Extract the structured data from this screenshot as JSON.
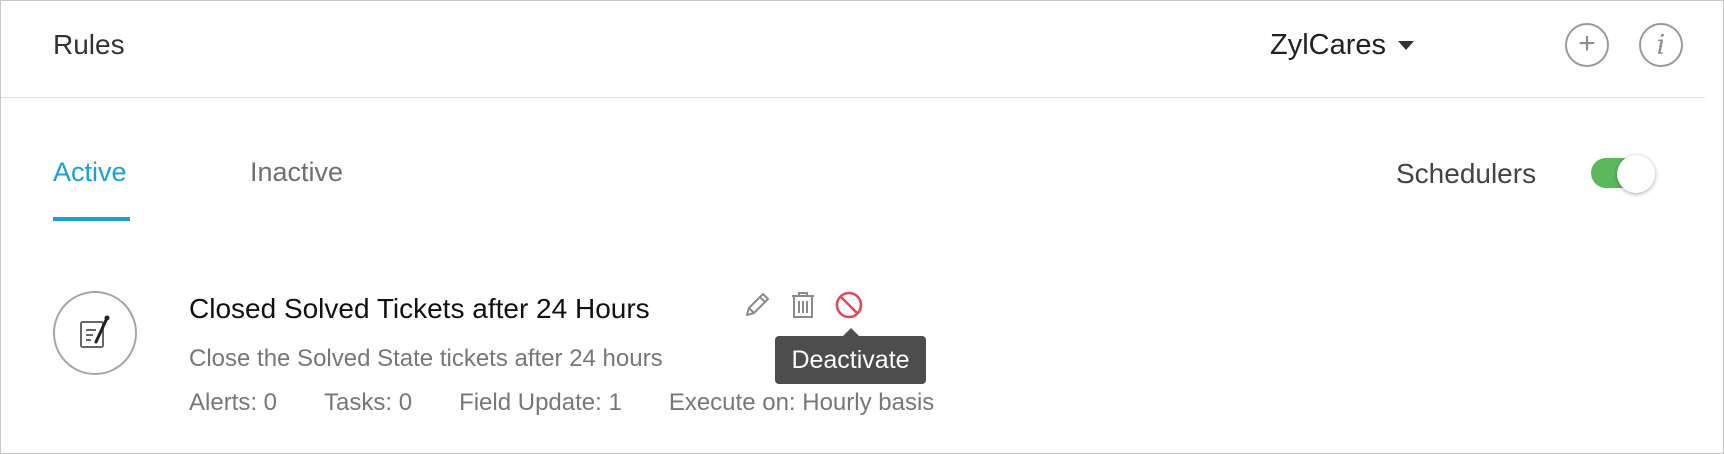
{
  "header": {
    "title": "Rules",
    "org_name": "ZylCares",
    "add_icon": "plus-circle-icon",
    "info_icon": "info-circle-icon"
  },
  "tabs": [
    {
      "label": "Active",
      "selected": true
    },
    {
      "label": "Inactive",
      "selected": false
    }
  ],
  "schedulers": {
    "label": "Schedulers",
    "enabled": true,
    "color": "#5cb85c"
  },
  "rule": {
    "title": "Closed Solved Tickets after 24 Hours",
    "description": "Close the Solved State tickets after 24 hours",
    "alerts": "Alerts: 0",
    "tasks": "Tasks: 0",
    "field_update": "Field Update: 1",
    "execute_on": "Execute on: Hourly basis",
    "icon": "rule-document-pen-icon"
  },
  "tooltip": {
    "text": "Deactivate"
  },
  "colors": {
    "accent": "#1aa0d8",
    "danger": "#e24a55",
    "toggle_on": "#5cb85c"
  }
}
